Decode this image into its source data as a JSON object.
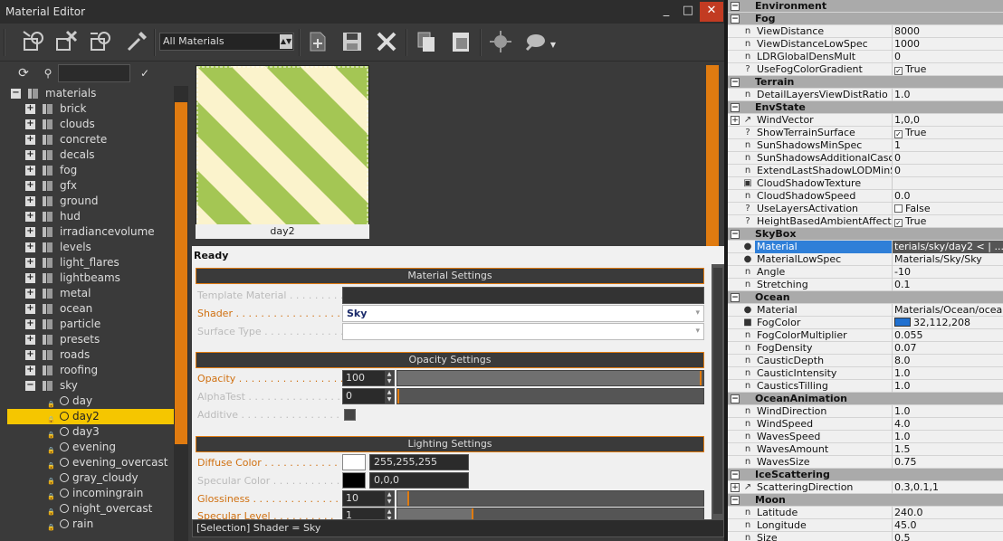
{
  "window": {
    "title": "Material Editor",
    "minimize": "_",
    "restore": "□",
    "close": "✕"
  },
  "toolbar": {
    "filter_value": "All Materials",
    "icons": [
      "get-from-selection-icon",
      "reset-icon",
      "assign-to-selection-icon",
      "pick-material-icon",
      "add-material-icon",
      "save-icon",
      "remove-icon",
      "copy-icon",
      "paste-icon",
      "preview-icon",
      "highlight-icon"
    ]
  },
  "tree": {
    "search_value": "",
    "apply_label": "✓",
    "items": [
      {
        "label": "materials",
        "kind": "root",
        "expander": "−"
      },
      {
        "label": "brick",
        "kind": "folder",
        "expander": "+"
      },
      {
        "label": "clouds",
        "kind": "folder",
        "expander": "+"
      },
      {
        "label": "concrete",
        "kind": "folder",
        "expander": "+"
      },
      {
        "label": "decals",
        "kind": "folder",
        "expander": "+"
      },
      {
        "label": "fog",
        "kind": "folder",
        "expander": "+"
      },
      {
        "label": "gfx",
        "kind": "folder",
        "expander": "+"
      },
      {
        "label": "ground",
        "kind": "folder",
        "expander": "+"
      },
      {
        "label": "hud",
        "kind": "folder",
        "expander": "+"
      },
      {
        "label": "irradiancevolume",
        "kind": "folder",
        "expander": "+"
      },
      {
        "label": "levels",
        "kind": "folder",
        "expander": "+"
      },
      {
        "label": "light_flares",
        "kind": "folder",
        "expander": "+"
      },
      {
        "label": "lightbeams",
        "kind": "folder",
        "expander": "+"
      },
      {
        "label": "metal",
        "kind": "folder",
        "expander": "+"
      },
      {
        "label": "ocean",
        "kind": "folder",
        "expander": "+"
      },
      {
        "label": "particle",
        "kind": "folder",
        "expander": "+"
      },
      {
        "label": "presets",
        "kind": "folder",
        "expander": "+"
      },
      {
        "label": "roads",
        "kind": "folder",
        "expander": "+"
      },
      {
        "label": "roofing",
        "kind": "folder",
        "expander": "+"
      },
      {
        "label": "sky",
        "kind": "folder",
        "expander": "−"
      },
      {
        "label": "day",
        "kind": "material"
      },
      {
        "label": "day2",
        "kind": "material",
        "selected": true
      },
      {
        "label": "day3",
        "kind": "material"
      },
      {
        "label": "evening",
        "kind": "material"
      },
      {
        "label": "evening_overcast",
        "kind": "material"
      },
      {
        "label": "gray_cloudy",
        "kind": "material"
      },
      {
        "label": "incomingrain",
        "kind": "material"
      },
      {
        "label": "night_overcast",
        "kind": "material"
      },
      {
        "label": "rain",
        "kind": "material"
      }
    ]
  },
  "preview": {
    "caption": "day2",
    "stripe_color": "#9cc24a",
    "base_color": "#fbf3cc"
  },
  "status": "Ready",
  "material_settings": {
    "header": "Material Settings",
    "template_label": "Template Material . . . . . . . . . .",
    "template_value": "",
    "shader_label": "Shader . . . . . . . . . . . . . . . . . .",
    "shader_value": "Sky",
    "surface_label": "Surface Type . . . . . . . . . . . . .",
    "surface_value": ""
  },
  "opacity_settings": {
    "header": "Opacity Settings",
    "opacity_label": "Opacity . . . . . . . . . . . . . . . . .",
    "opacity_value": "100",
    "opacity_level": 1.0,
    "alphatest_label": "AlphaTest . . . . . . . . . . . . . . .",
    "alphatest_value": "0",
    "alphatest_level": 0.0,
    "additive_label": "Additive . . . . . . . . . . . . . . . ."
  },
  "lighting_settings": {
    "header": "Lighting Settings",
    "diffuse_label": "Diffuse Color . . . . . . . . . . . .",
    "diffuse_value": "255,255,255",
    "specular_label": "Specular Color . . . . . . . . . . .",
    "specular_value": "0,0,0",
    "gloss_label": "Glossiness . . . . . . . . . . . . . .",
    "gloss_value": "10",
    "gloss_level": 0.04,
    "speclevel_label": "Specular Level . . . . . . . . . .",
    "speclevel_value": "1",
    "speclevel_level": 0.25
  },
  "statusbar": "[Selection] Shader = Sky",
  "env_rows": [
    {
      "t": "hd",
      "label": "Environment",
      "tog": "−"
    },
    {
      "t": "hd",
      "label": "Fog",
      "tog": "−"
    },
    {
      "t": "p",
      "ic": "n",
      "k": "ViewDistance",
      "v": "8000"
    },
    {
      "t": "p",
      "ic": "n",
      "k": "ViewDistanceLowSpec",
      "v": "1000"
    },
    {
      "t": "p",
      "ic": "n",
      "k": "LDRGlobalDensMult",
      "v": "0"
    },
    {
      "t": "p",
      "ic": "?",
      "k": "UseFogColorGradient",
      "v": "True",
      "cb": "✓"
    },
    {
      "t": "hd",
      "label": "Terrain",
      "tog": "−"
    },
    {
      "t": "p",
      "ic": "n",
      "k": "DetailLayersViewDistRatio",
      "v": "1.0"
    },
    {
      "t": "hd",
      "label": "EnvState",
      "tog": "−"
    },
    {
      "t": "p",
      "ic": "↗",
      "k": "WindVector",
      "v": "1,0,0",
      "tog": "+"
    },
    {
      "t": "p",
      "ic": "?",
      "k": "ShowTerrainSurface",
      "v": "True",
      "cb": "✓"
    },
    {
      "t": "p",
      "ic": "n",
      "k": "SunShadowsMinSpec",
      "v": "1"
    },
    {
      "t": "p",
      "ic": "n",
      "k": "SunShadowsAdditionalCascade",
      "v": "0"
    },
    {
      "t": "p",
      "ic": "n",
      "k": "ExtendLastShadowLODMinSpec",
      "v": "0"
    },
    {
      "t": "p",
      "ic": "▣",
      "k": "CloudShadowTexture",
      "v": ""
    },
    {
      "t": "p",
      "ic": "n",
      "k": "CloudShadowSpeed",
      "v": "0.0"
    },
    {
      "t": "p",
      "ic": "?",
      "k": "UseLayersActivation",
      "v": "False",
      "cb": " "
    },
    {
      "t": "p",
      "ic": "?",
      "k": "HeightBasedAmbientAffectsGlobal",
      "v": "True",
      "cb": "✓"
    },
    {
      "t": "hd",
      "label": "SkyBox",
      "tog": "−"
    },
    {
      "t": "p",
      "ic": "●",
      "k": "Material",
      "v": "terials/sky/day2  < | ...",
      "sel": true
    },
    {
      "t": "p",
      "ic": "●",
      "k": "MaterialLowSpec",
      "v": "Materials/Sky/Sky"
    },
    {
      "t": "p",
      "ic": "n",
      "k": "Angle",
      "v": "-10"
    },
    {
      "t": "p",
      "ic": "n",
      "k": "Stretching",
      "v": "0.1"
    },
    {
      "t": "hd",
      "label": "Ocean",
      "tog": "−"
    },
    {
      "t": "p",
      "ic": "●",
      "k": "Material",
      "v": "Materials/Ocean/ocean..."
    },
    {
      "t": "p",
      "ic": "■",
      "k": "FogColor",
      "v": "32,112,208",
      "swatch": "#2070d0"
    },
    {
      "t": "p",
      "ic": "n",
      "k": "FogColorMultiplier",
      "v": "0.055"
    },
    {
      "t": "p",
      "ic": "n",
      "k": "FogDensity",
      "v": "0.07"
    },
    {
      "t": "p",
      "ic": "n",
      "k": "CausticDepth",
      "v": "8.0"
    },
    {
      "t": "p",
      "ic": "n",
      "k": "CausticIntensity",
      "v": "1.0"
    },
    {
      "t": "p",
      "ic": "n",
      "k": "CausticsTilling",
      "v": "1.0"
    },
    {
      "t": "hd",
      "label": "OceanAnimation",
      "tog": "−"
    },
    {
      "t": "p",
      "ic": "n",
      "k": "WindDirection",
      "v": "1.0"
    },
    {
      "t": "p",
      "ic": "n",
      "k": "WindSpeed",
      "v": "4.0"
    },
    {
      "t": "p",
      "ic": "n",
      "k": "WavesSpeed",
      "v": "1.0"
    },
    {
      "t": "p",
      "ic": "n",
      "k": "WavesAmount",
      "v": "1.5"
    },
    {
      "t": "p",
      "ic": "n",
      "k": "WavesSize",
      "v": "0.75"
    },
    {
      "t": "hd",
      "label": "IceScattering",
      "tog": "−"
    },
    {
      "t": "p",
      "ic": "↗",
      "k": "ScatteringDirection",
      "v": "0.3,0.1,1",
      "tog": "+"
    },
    {
      "t": "hd",
      "label": "Moon",
      "tog": "−"
    },
    {
      "t": "p",
      "ic": "n",
      "k": "Latitude",
      "v": "240.0"
    },
    {
      "t": "p",
      "ic": "n",
      "k": "Longitude",
      "v": "45.0"
    },
    {
      "t": "p",
      "ic": "n",
      "k": "Size",
      "v": "0.5"
    }
  ]
}
